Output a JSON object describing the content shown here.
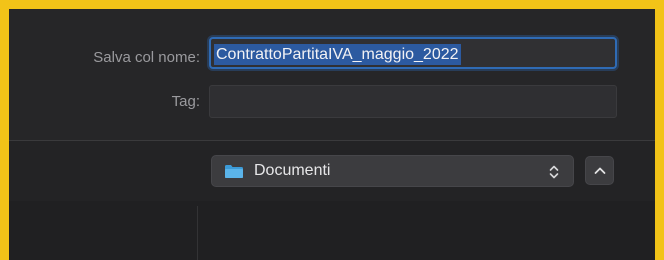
{
  "save_dialog": {
    "save_as_label": "Salva col nome:",
    "filename": "ContrattoPartitaIVA_maggio_2022",
    "tags_label": "Tag:",
    "tags_value": "",
    "location": {
      "label": "Documenti",
      "icon": "folder-icon"
    },
    "expand_icon": "chevron-up-icon"
  },
  "colors": {
    "frame_border": "#f2c318",
    "background": "#262628",
    "focus_ring": "#2f6bb5",
    "selection": "#2c5aa0",
    "folder_icon": "#3c9bd8"
  }
}
